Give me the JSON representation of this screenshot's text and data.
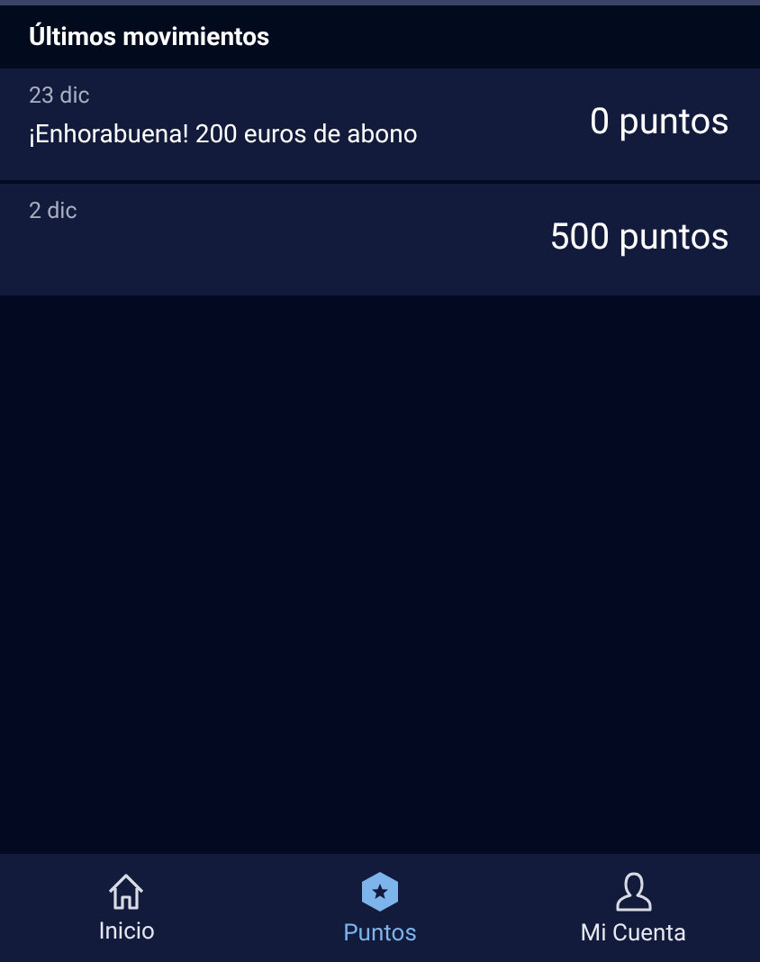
{
  "header": {
    "title": "Últimos movimientos"
  },
  "movements": [
    {
      "date": "23 dic",
      "description": "¡Enhorabuena! 200 euros de abono",
      "points": "0 puntos"
    },
    {
      "date": "2 dic",
      "points": "500 puntos"
    }
  ],
  "bottom_nav": [
    {
      "kind": "home",
      "label": "Inicio",
      "selected": false
    },
    {
      "kind": "points",
      "label": "Puntos",
      "selected": true
    },
    {
      "kind": "account",
      "label": "Mi Cuenta",
      "selected": false
    }
  ]
}
